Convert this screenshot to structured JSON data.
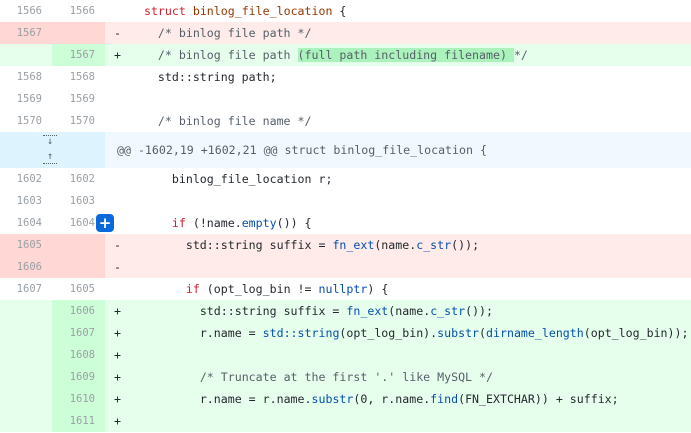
{
  "colors": {
    "del_bg": "#ffebe9",
    "del_num_bg": "#ffd7d5",
    "add_bg": "#e6ffec",
    "add_num_bg": "#ccffd8",
    "add_highlight": "#abf2bc",
    "hunk_bg": "#f1f8ff",
    "expand_bg": "#ddf4ff",
    "add_comment_button": "#0969da"
  },
  "rows_top": [
    {
      "type": "ctx",
      "old": "1566",
      "new": "1566",
      "marker": "",
      "indent": "  ",
      "parts": [
        {
          "t": "kw",
          "v": "struct"
        },
        {
          "t": "",
          "v": " "
        },
        {
          "t": "sym",
          "v": "binlog_file_location"
        },
        {
          "t": "",
          "v": " {"
        }
      ]
    },
    {
      "type": "del",
      "old": "1567",
      "new": "",
      "marker": "-",
      "indent": "    ",
      "parts": [
        {
          "t": "cmt",
          "v": "/* binlog file path */"
        }
      ]
    },
    {
      "type": "add",
      "old": "",
      "new": "1567",
      "marker": "+",
      "indent": "    ",
      "parts": [
        {
          "t": "cmt",
          "v": "/* binlog file path "
        },
        {
          "t": "cmt hl-add",
          "v": "(full path including filename) "
        },
        {
          "t": "cmt",
          "v": "*/"
        }
      ]
    },
    {
      "type": "ctx",
      "old": "1568",
      "new": "1568",
      "marker": "",
      "indent": "    ",
      "parts": [
        {
          "t": "",
          "v": "std::string path;"
        }
      ]
    },
    {
      "type": "ctx",
      "old": "1569",
      "new": "1569",
      "marker": "",
      "indent": "",
      "parts": []
    },
    {
      "type": "ctx",
      "old": "1570",
      "new": "1570",
      "marker": "",
      "indent": "    ",
      "parts": [
        {
          "t": "cmt",
          "v": "/* binlog file name */"
        }
      ]
    }
  ],
  "hunk": {
    "header": "@@ -1602,19 +1602,21 @@ struct binlog_file_location {"
  },
  "rows_bottom": [
    {
      "type": "ctx",
      "old": "1602",
      "new": "1602",
      "marker": "",
      "indent": "      ",
      "parts": [
        {
          "t": "",
          "v": "binlog_file_location r;"
        }
      ]
    },
    {
      "type": "ctx",
      "old": "1603",
      "new": "1603",
      "marker": "",
      "indent": "",
      "parts": []
    },
    {
      "type": "ctx",
      "old": "1604",
      "new": "1604",
      "marker": "",
      "indent": "      ",
      "btn": true,
      "parts": [
        {
          "t": "kw",
          "v": "if"
        },
        {
          "t": "",
          "v": " (!name."
        },
        {
          "t": "fn",
          "v": "empty"
        },
        {
          "t": "",
          "v": "()) {"
        }
      ]
    },
    {
      "type": "del",
      "old": "1605",
      "new": "",
      "marker": "-",
      "indent": "        ",
      "parts": [
        {
          "t": "",
          "v": "std::string suffix = "
        },
        {
          "t": "fn",
          "v": "fn_ext"
        },
        {
          "t": "",
          "v": "(name."
        },
        {
          "t": "fn",
          "v": "c_str"
        },
        {
          "t": "",
          "v": "());"
        }
      ]
    },
    {
      "type": "del",
      "old": "1606",
      "new": "",
      "marker": "-",
      "indent": "",
      "parts": []
    },
    {
      "type": "ctx",
      "old": "1607",
      "new": "1605",
      "marker": "",
      "indent": "        ",
      "parts": [
        {
          "t": "kw",
          "v": "if"
        },
        {
          "t": "",
          "v": " (opt_log_bin != "
        },
        {
          "t": "fn",
          "v": "nullptr"
        },
        {
          "t": "",
          "v": ") {"
        }
      ]
    },
    {
      "type": "add",
      "old": "",
      "new": "1606",
      "marker": "+",
      "indent": "          ",
      "parts": [
        {
          "t": "",
          "v": "std::string suffix = "
        },
        {
          "t": "fn",
          "v": "fn_ext"
        },
        {
          "t": "",
          "v": "(name."
        },
        {
          "t": "fn",
          "v": "c_str"
        },
        {
          "t": "",
          "v": "());"
        }
      ]
    },
    {
      "type": "add",
      "old": "",
      "new": "1607",
      "marker": "+",
      "indent": "          ",
      "parts": [
        {
          "t": "",
          "v": "r.name = "
        },
        {
          "t": "fn",
          "v": "std::string"
        },
        {
          "t": "",
          "v": "(opt_log_bin)."
        },
        {
          "t": "fn",
          "v": "substr"
        },
        {
          "t": "",
          "v": "("
        },
        {
          "t": "fn",
          "v": "dirname_length"
        },
        {
          "t": "",
          "v": "(opt_log_bin));"
        }
      ]
    },
    {
      "type": "add",
      "old": "",
      "new": "1608",
      "marker": "+",
      "indent": "",
      "parts": []
    },
    {
      "type": "add",
      "old": "",
      "new": "1609",
      "marker": "+",
      "indent": "          ",
      "parts": [
        {
          "t": "cmt",
          "v": "/* Truncate at the first '.' like MySQL */"
        }
      ]
    },
    {
      "type": "add",
      "old": "",
      "new": "1610",
      "marker": "+",
      "indent": "          ",
      "parts": [
        {
          "t": "",
          "v": "r.name = r.name."
        },
        {
          "t": "fn",
          "v": "substr"
        },
        {
          "t": "",
          "v": "(0, r.name."
        },
        {
          "t": "fn",
          "v": "find"
        },
        {
          "t": "",
          "v": "(FN_EXTCHAR)) + suffix;"
        }
      ]
    },
    {
      "type": "add",
      "old": "",
      "new": "1611",
      "marker": "+",
      "indent": "",
      "parts": []
    }
  ]
}
